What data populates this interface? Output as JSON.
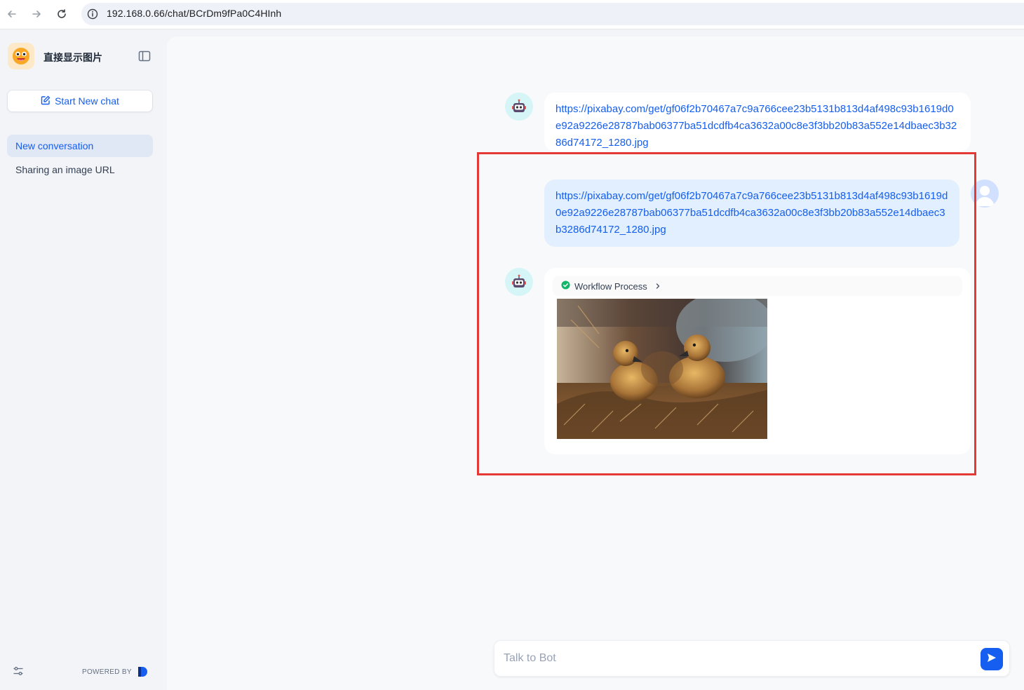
{
  "browser": {
    "url": "192.168.0.66/chat/BCrDm9fPa0C4HInh"
  },
  "sidebar": {
    "app_title": "直接显示图片",
    "new_chat_label": "Start New chat",
    "conversations": [
      {
        "label": "New conversation",
        "active": true
      },
      {
        "label": "Sharing an image URL",
        "active": false
      }
    ],
    "powered_by": "POWERED BY"
  },
  "chat": {
    "messages": [
      {
        "role": "bot",
        "text": "https://pixabay.com/get/gf06f2b70467a7c9a766cee23b5131b813d4af498c93b1619d0e92a9226e28787bab06377ba51dcdfb4ca3632a00c8e3f3bb20b83a552e14dbaec3b3286d74172_1280.jpg"
      },
      {
        "role": "user",
        "text": "https://pixabay.com/get/gf06f2b70467a7c9a766cee23b5131b813d4af498c93b1619d0e92a9226e28787bab06377ba51dcdfb4ca3632a00c8e3f3bb20b83a552e14dbaec3b3286d74172_1280.jpg"
      },
      {
        "role": "bot",
        "workflow_label": "Workflow Process",
        "workflow_status": "succeeded",
        "image_subject": "two goslings on dry grass"
      }
    ],
    "input_placeholder": "Talk to Bot"
  },
  "colors": {
    "accent": "#155eef",
    "highlight": "#e53935",
    "user_bubble": "#e1effe",
    "success": "#12b76a"
  }
}
